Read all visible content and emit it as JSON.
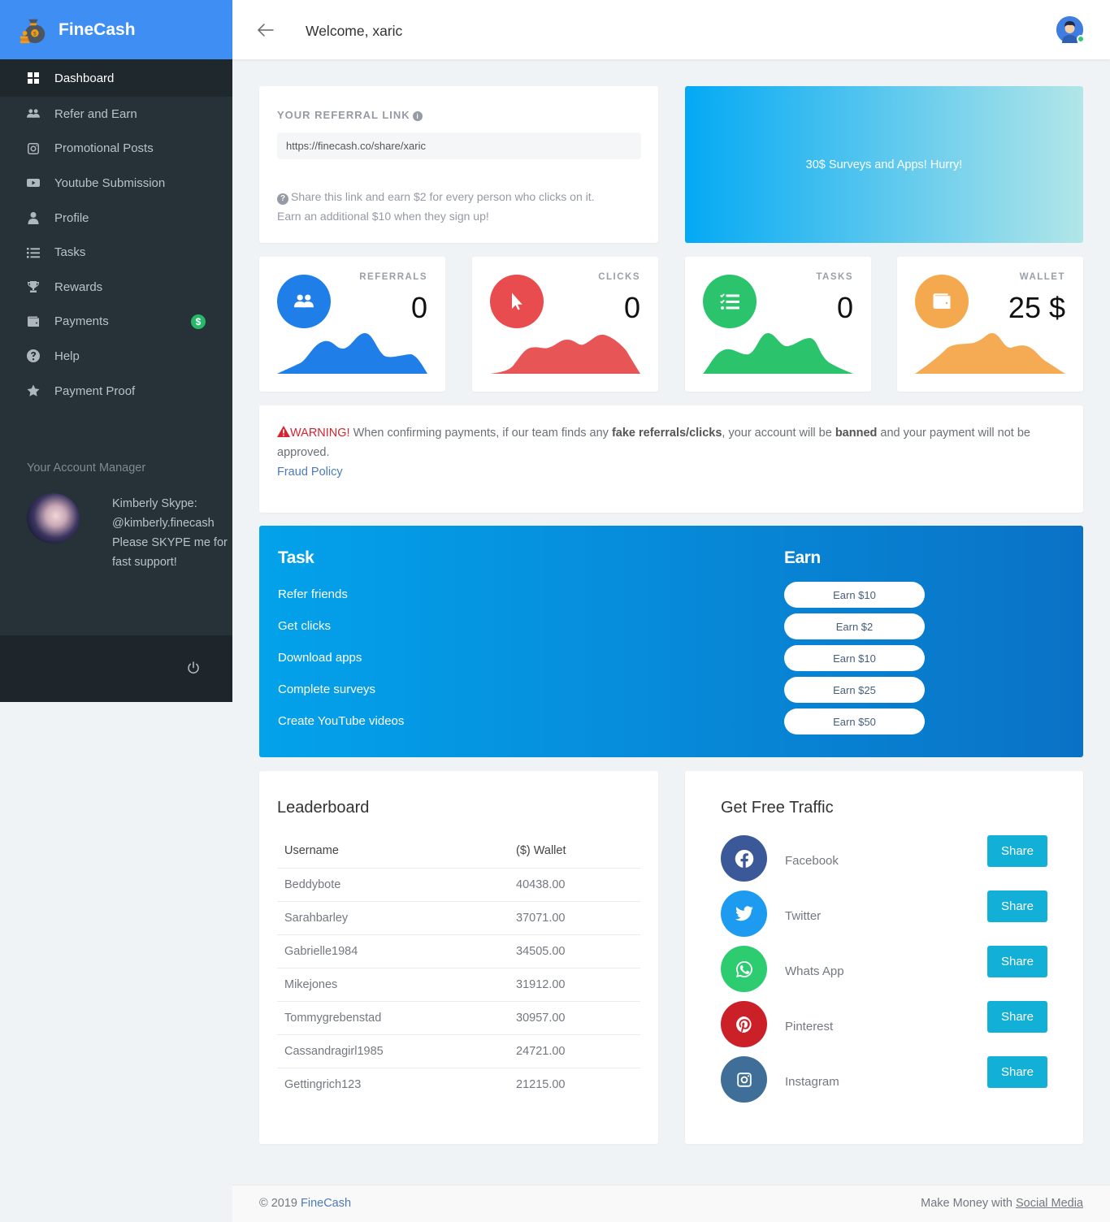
{
  "brand": {
    "name": "FineCash"
  },
  "sidebar": {
    "items": [
      {
        "label": "Dashboard",
        "icon": "dashboard-icon",
        "active": true
      },
      {
        "label": "Refer and Earn",
        "icon": "users-icon"
      },
      {
        "label": "Promotional Posts",
        "icon": "instagram-icon"
      },
      {
        "label": "Youtube Submission",
        "icon": "youtube-icon"
      },
      {
        "label": "Profile",
        "icon": "user-icon"
      },
      {
        "label": "Tasks",
        "icon": "list-icon"
      },
      {
        "label": "Rewards",
        "icon": "trophy-icon"
      },
      {
        "label": "Payments",
        "icon": "wallet-icon",
        "badge": "$"
      },
      {
        "label": "Help",
        "icon": "question-icon"
      },
      {
        "label": "Payment Proof",
        "icon": "star-icon"
      }
    ],
    "manager": {
      "title": "Your Account Manager",
      "text": "Kimberly Skype: @kimberly.finecash Please SKYPE me for fast support!"
    }
  },
  "header": {
    "welcome": "Welcome, xaric"
  },
  "referral": {
    "label": "YOUR REFERRAL LINK",
    "link": "https://finecash.co/share/xaric",
    "help_line1": "Share this link and earn $2 for every person who clicks on it.",
    "help_line2": "Earn an additional $10 when they sign up!"
  },
  "promo": {
    "text": "30$ Surveys and Apps! Hurry!"
  },
  "stats": [
    {
      "label": "REFERRALS",
      "value": "0",
      "color": "#1f7ee8",
      "icon": "users-icon"
    },
    {
      "label": "CLICKS",
      "value": "0",
      "color": "#e84c4e",
      "icon": "cursor-icon"
    },
    {
      "label": "TASKS",
      "value": "0",
      "color": "#2bc46d",
      "icon": "tasks-icon"
    },
    {
      "label": "WALLET",
      "value": "25 $",
      "color": "#f4a94f",
      "icon": "wallet-icon"
    }
  ],
  "warning": {
    "prefix": "WARNING!",
    "text1": " When confirming payments, if our team finds any ",
    "bold1": "fake referrals/clicks",
    "text2": ", your account will be ",
    "bold2": "banned",
    "text3": " and your payment will not be approved.",
    "link": "Fraud Policy"
  },
  "tasks": {
    "task_header": "Task",
    "earn_header": "Earn",
    "items": [
      {
        "task": "Refer friends",
        "earn": "Earn $10"
      },
      {
        "task": "Get clicks",
        "earn": "Earn $2"
      },
      {
        "task": "Download apps",
        "earn": "Earn $10"
      },
      {
        "task": "Complete surveys",
        "earn": "Earn $25"
      },
      {
        "task": "Create YouTube videos",
        "earn": "Earn $50"
      }
    ]
  },
  "leaderboard": {
    "title": "Leaderboard",
    "columns": [
      "Username",
      "($) Wallet"
    ],
    "rows": [
      [
        "Beddybote",
        "40438.00"
      ],
      [
        "Sarahbarley",
        "37071.00"
      ],
      [
        "Gabrielle1984",
        "34505.00"
      ],
      [
        "Mikejones",
        "31912.00"
      ],
      [
        "Tommygrebenstad",
        "30957.00"
      ],
      [
        "Cassandragirl1985",
        "24721.00"
      ],
      [
        "Gettingrich123",
        "21215.00"
      ]
    ]
  },
  "traffic": {
    "title": "Get Free Traffic",
    "share_label": "Share",
    "items": [
      {
        "name": "Facebook",
        "icon": "facebook-icon",
        "color": "#3b5998"
      },
      {
        "name": "Twitter",
        "icon": "twitter-icon",
        "color": "#1da1f2"
      },
      {
        "name": "Whats App",
        "icon": "whatsapp-icon",
        "color": "#25d366"
      },
      {
        "name": "Pinterest",
        "icon": "pinterest-icon",
        "color": "#cb2027"
      },
      {
        "name": "Instagram",
        "icon": "instagram-icon",
        "color": "#3f729b"
      }
    ]
  },
  "footer": {
    "copyright": "© 2019 ",
    "brand_link": "FineCash",
    "right_text": "Make Money with ",
    "right_link": "Social Media"
  }
}
